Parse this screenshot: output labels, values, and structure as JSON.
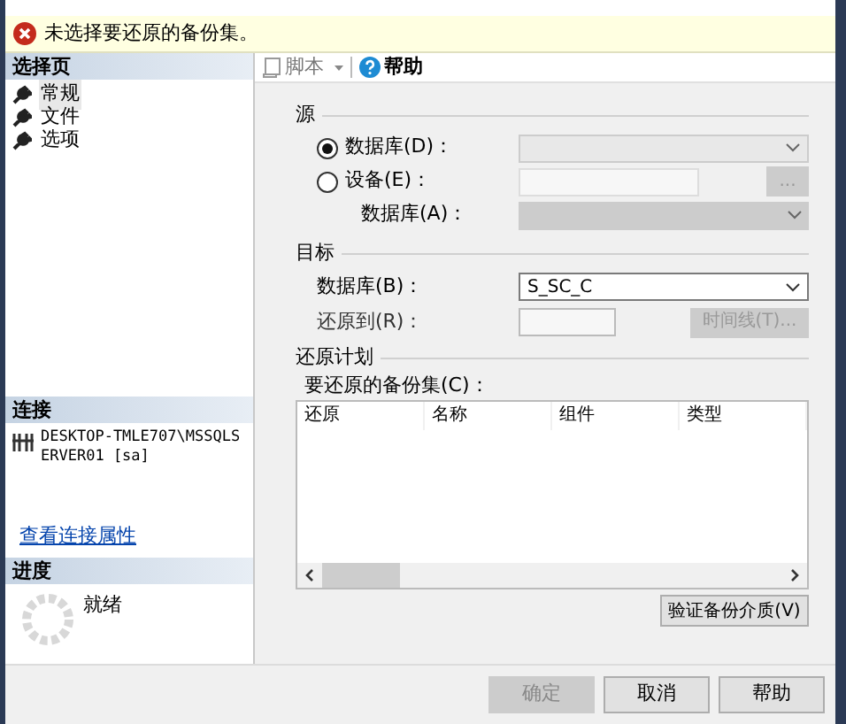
{
  "message": {
    "text": "未选择要还原的备份集。"
  },
  "sidebar": {
    "header": "选择页",
    "items": [
      {
        "label": "常规",
        "selected": true
      },
      {
        "label": "文件",
        "selected": false
      },
      {
        "label": "选项",
        "selected": false
      }
    ]
  },
  "connection": {
    "header": "连接",
    "server": "DESKTOP-TMLE707\\MSSQLSERVER01 [sa]",
    "link": "查看连接属性"
  },
  "progress": {
    "header": "进度",
    "status": "就绪"
  },
  "toolbar": {
    "script": "脚本",
    "help": "帮助"
  },
  "source": {
    "header": "源",
    "database_radio": {
      "label": "数据库(D)：",
      "selected": true
    },
    "database_value": {
      "disabled": true
    },
    "device_radio": {
      "label": "设备(E)：",
      "selected": false
    },
    "browse": {
      "label": "...",
      "disabled": true
    },
    "device_database": {
      "label": "数据库(A)：",
      "disabled": true
    }
  },
  "destination": {
    "header": "目标",
    "database_label": "数据库(B)：",
    "database_value": "S_SC_C",
    "restore_to_label": "还原到(R)：",
    "timeline": {
      "label": "时间线(T)...",
      "disabled": true
    }
  },
  "plan": {
    "header": "还原计划",
    "label": "要还原的备份集(C)：",
    "columns": [
      "还原",
      "名称",
      "组件",
      "类型"
    ],
    "verify": {
      "label": "验证备份介质(V)",
      "disabled": false
    }
  },
  "buttons": [
    {
      "label": "确定",
      "disabled": true
    },
    {
      "label": "取消",
      "disabled": false
    },
    {
      "label": "帮助",
      "disabled": false
    }
  ]
}
